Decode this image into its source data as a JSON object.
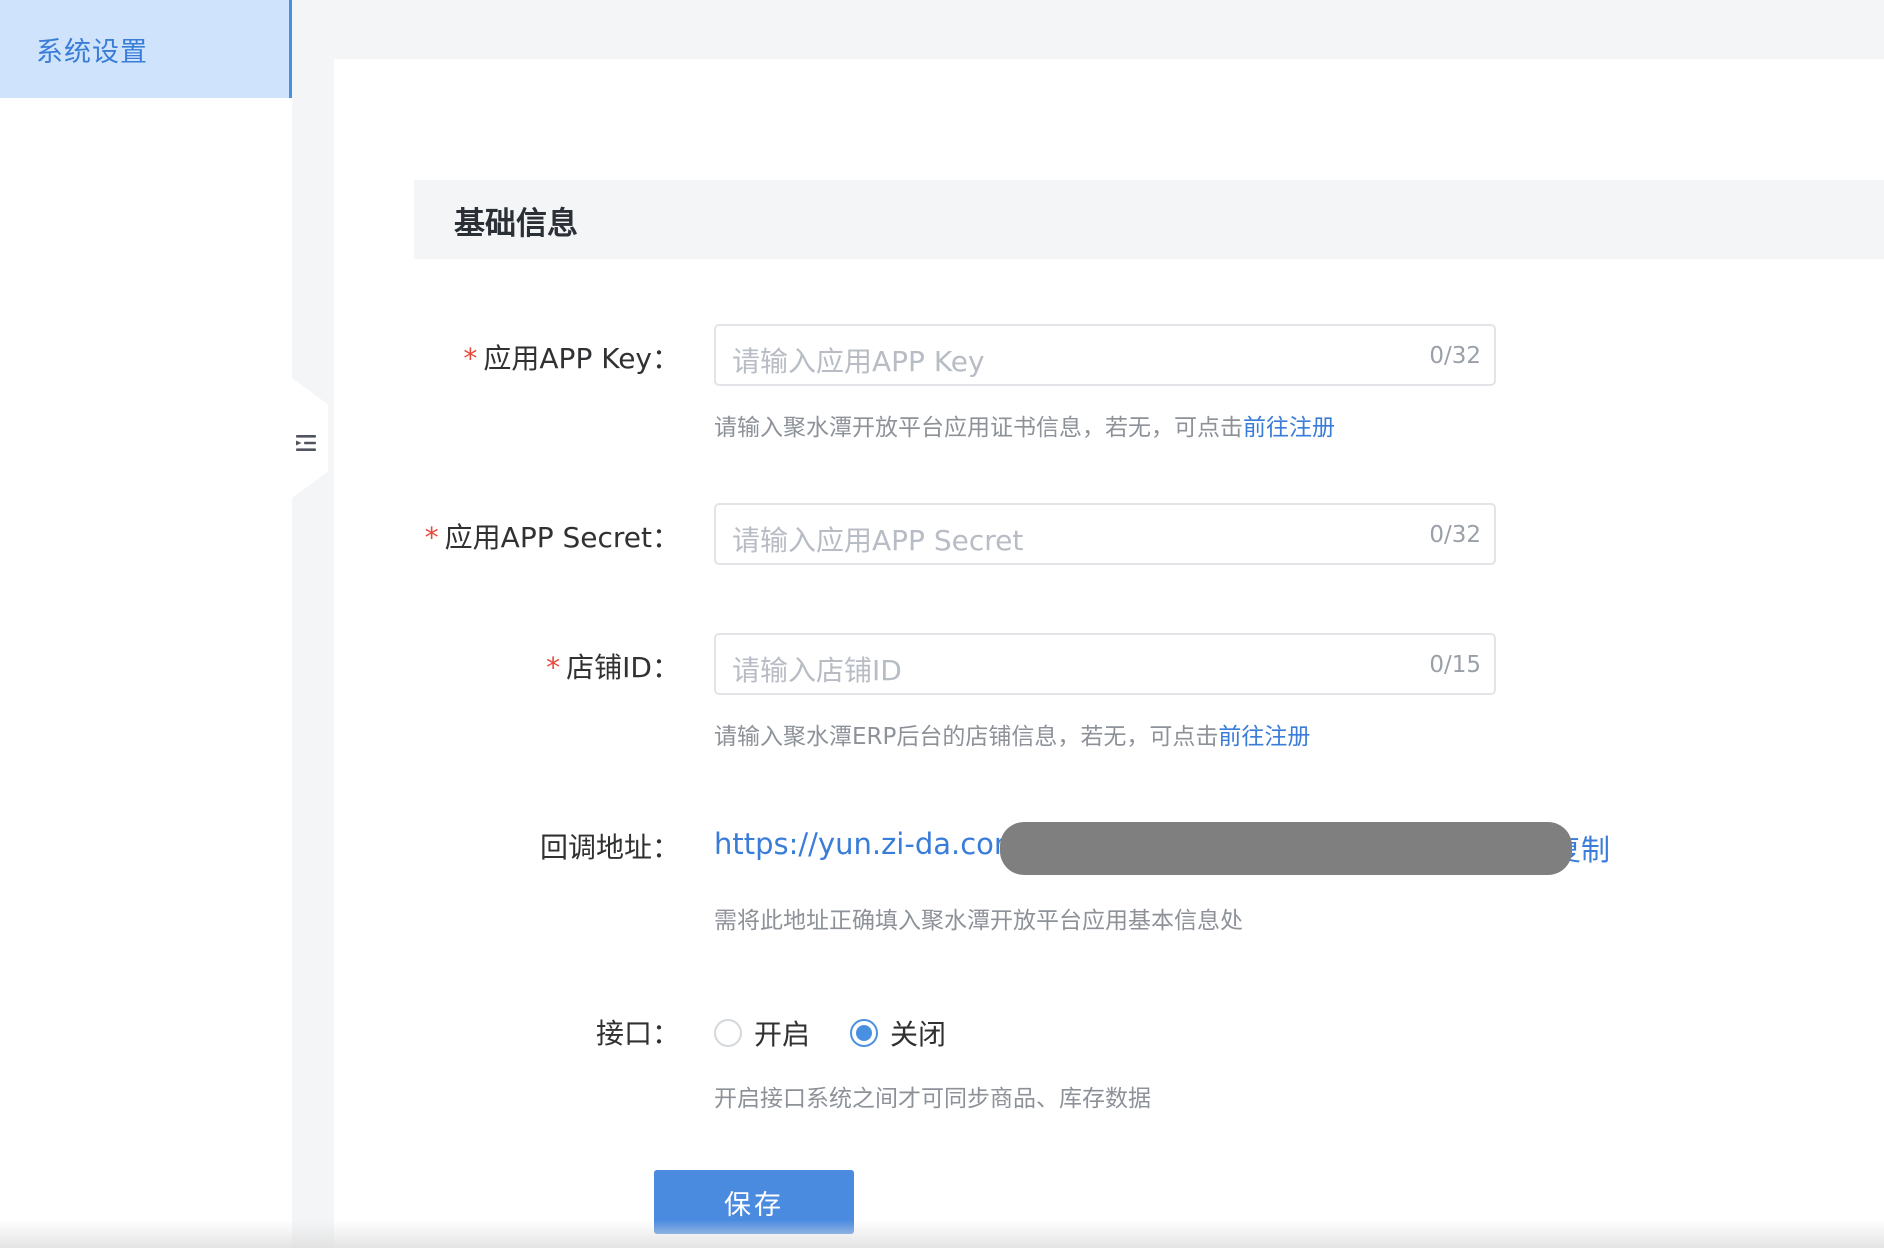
{
  "sidebar": {
    "menu_item": "系统设置"
  },
  "section": {
    "title": "基础信息"
  },
  "form": {
    "app_key": {
      "required": "*",
      "label": "应用APP Key：",
      "placeholder": "请输入应用APP Key",
      "count": "0/32",
      "hint": "请输入聚水潭开放平台应用证书信息，若无，可点击",
      "hint_link": "前往注册"
    },
    "app_secret": {
      "required": "*",
      "label": "应用APP Secret：",
      "placeholder": "请输入应用APP Secret",
      "count": "0/32"
    },
    "shop_id": {
      "required": "*",
      "label": "店铺ID：",
      "placeholder": "请输入店铺ID",
      "count": "0/15",
      "hint": "请输入聚水潭ERP后台的店铺信息，若无，可点击",
      "hint_link": "前往注册"
    },
    "callback": {
      "label": "回调地址：",
      "url": "https://yun.zi-da.com",
      "copy": "复制",
      "hint": "需将此地址正确填入聚水潭开放平台应用基本信息处"
    },
    "interface": {
      "label": "接口：",
      "options": [
        "开启",
        "关闭"
      ],
      "selected": "关闭",
      "hint": "开启接口系统之间才可同步商品、库存数据"
    },
    "save_label": "保存"
  },
  "colors": {
    "accent": "#4a90e2",
    "required": "#e8473b",
    "sidebar_active_bg": "#cfe4fc",
    "redaction": "#7f7f80"
  },
  "icons": {
    "collapse": "indent-menu-icon"
  }
}
